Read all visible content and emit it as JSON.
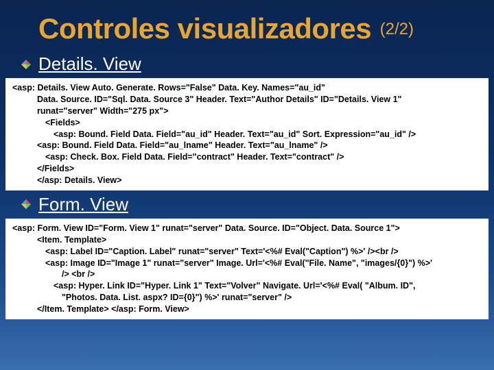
{
  "title": {
    "main": "Controles visualizadores",
    "sub": "(2/2)"
  },
  "sections": {
    "details": {
      "heading": "Details. View"
    },
    "form": {
      "heading": "Form. View"
    }
  },
  "code": {
    "d0": "<asp: Details. View Auto. Generate. Rows=\"False\" Data. Key. Names=\"au_id\"",
    "d1": "Data. Source. ID=\"Sql. Data. Source 3\" Header. Text=\"Author Details\" ID=\"Details. View 1\"",
    "d2": "runat=\"server\" Width=\"275 px\">",
    "d3": "<Fields>",
    "d4": "<asp: Bound. Field Data. Field=\"au_id\" Header. Text=\"au_id\" Sort. Expression=\"au_id\" />",
    "d5": "<asp: Bound. Field Data. Field=\"au_lname\" Header. Text=\"au_lname\" />",
    "d6": "<asp: Check. Box. Field Data. Field=\"contract\" Header. Text=\"contract\" />",
    "d7": "</Fields>",
    "d8": "</asp: Details. View>",
    "f0": "<asp: Form. View ID=\"Form. View 1\" runat=\"server\" Data. Source. ID=\"Object. Data. Source 1\">",
    "f1": "<Item. Template>",
    "f2": "<asp: Label ID=\"Caption. Label\" runat=\"server\" Text='<%# Eval(\"Caption\") %>' /><br />",
    "f3": "<asp: Image ID=\"Image 1\" runat=\"server\" Image. Url='<%# Eval(\"File. Name\", \"images/{0}\") %>'",
    "f4": "/> <br />",
    "f5": "<asp: Hyper. Link ID=\"Hyper. Link 1\" Text=\"Volver\" Navigate. Url='<%# Eval( \"Album. ID\",",
    "f6": "\"Photos. Data. List. aspx? ID={0}\") %>' runat=\"server\" />",
    "f7": "</Item. Template> </asp: Form. View>"
  }
}
